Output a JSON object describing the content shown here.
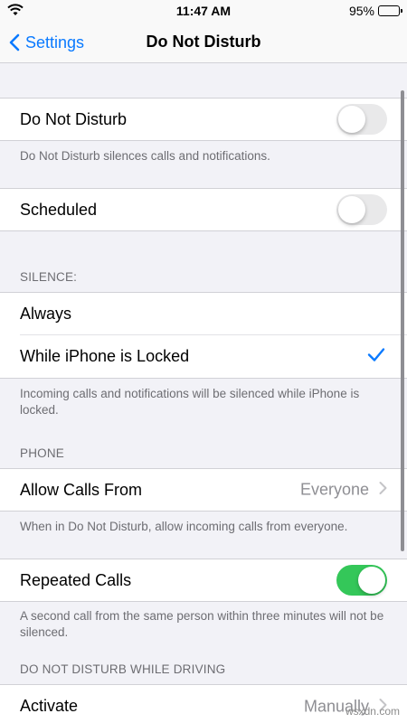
{
  "status_bar": {
    "time": "11:47 AM",
    "battery_percent": "95%",
    "battery_level": 0.95
  },
  "nav": {
    "back_label": "Settings",
    "title": "Do Not Disturb"
  },
  "dnd": {
    "label": "Do Not Disturb",
    "enabled": false,
    "footer": "Do Not Disturb silences calls and notifications."
  },
  "scheduled": {
    "label": "Scheduled",
    "enabled": false
  },
  "silence": {
    "header": "SILENCE:",
    "options": [
      {
        "label": "Always",
        "selected": false
      },
      {
        "label": "While iPhone is Locked",
        "selected": true
      }
    ],
    "footer": "Incoming calls and notifications will be silenced while iPhone is locked."
  },
  "phone": {
    "header": "PHONE",
    "allow_calls": {
      "label": "Allow Calls From",
      "value": "Everyone"
    },
    "footer": "When in Do Not Disturb, allow incoming calls from everyone.",
    "repeated_calls": {
      "label": "Repeated Calls",
      "enabled": true
    },
    "repeated_footer": "A second call from the same person within three minutes will not be silenced."
  },
  "driving": {
    "header": "DO NOT DISTURB WHILE DRIVING",
    "activate": {
      "label": "Activate",
      "value": "Manually"
    }
  },
  "watermark": "wsxdn.com",
  "colors": {
    "accent": "#0a7aff",
    "toggle_on": "#34c759",
    "background": "#f2f2f7"
  }
}
